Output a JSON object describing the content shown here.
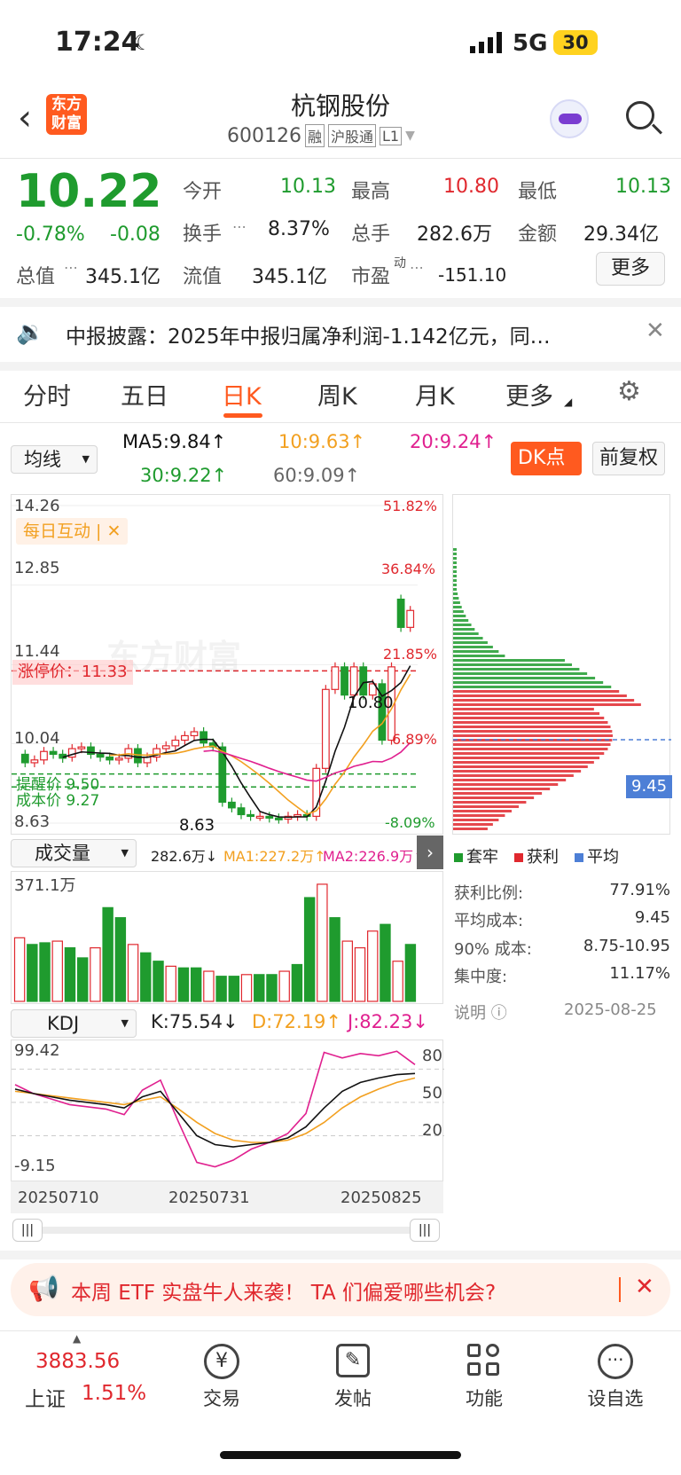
{
  "status_bar": {
    "time": "17:24",
    "network": "5G",
    "battery": "30"
  },
  "header": {
    "title": "杭钢股份",
    "logo": "东方财富",
    "code": "600126",
    "tags": [
      "融",
      "沪股通",
      "L1"
    ]
  },
  "quote": {
    "price": "10.22",
    "change_pct": "-0.78%",
    "change": "-0.08",
    "open_label": "今开",
    "open": "10.13",
    "high_label": "最高",
    "high": "10.80",
    "low_label": "最低",
    "low": "10.13",
    "turnover_label": "换手",
    "turnover": "8.37%",
    "volume_label": "总手",
    "volume": "282.6万",
    "amount_label": "金额",
    "amount": "29.34亿",
    "mktcap_label": "总值",
    "mktcap": "345.1亿",
    "float_label": "流值",
    "float": "345.1亿",
    "pe_label": "市盈",
    "pe_sup": "动",
    "pe": "-151.10",
    "more": "更多"
  },
  "notice": {
    "text": "中报披露：2025年中报归属净利润-1.142亿元，同…"
  },
  "tabs": [
    "分时",
    "五日",
    "日K",
    "周K",
    "月K",
    "更多"
  ],
  "active_tab": 2,
  "ma_bar": {
    "selector": "均线",
    "ma5": "MA5:9.84↑",
    "ma10": "10:9.63↑",
    "ma20": "20:9.24↑",
    "ma30": "30:9.22↑",
    "ma60": "60:9.09↑",
    "dk": "DK点",
    "fq": "前复权"
  },
  "colors": {
    "ma5": "#111111",
    "ma10": "#f2a020",
    "ma20": "#e0208f",
    "ma30": "#1f9b2e",
    "ma60": "#888888",
    "up": "#e0282e",
    "down": "#1f9b2e",
    "brand": "#ff5a1f"
  },
  "kchart": {
    "ymax": "14.26",
    "y2": "12.85",
    "y3": "11.44",
    "y4": "10.04",
    "ymin": "8.63",
    "pct_1": "51.82%",
    "pct_2": "36.84%",
    "pct_3": "21.85%",
    "pct_4": "6.89%",
    "pct_5": "-8.09%",
    "limit_up": "涨停价：11.33",
    "alert": "提醒价 9.50",
    "cost": "成本价 9.27",
    "high_mark": "10.80",
    "low_mark": "8.63",
    "interact": "每日互动 | ✕",
    "watermark": "东方财富",
    "chip_avg": "9.45"
  },
  "chart_data": {
    "type": "candlestick",
    "ylim": [
      8.63,
      14.26
    ],
    "candles": [
      {
        "o": 9.85,
        "c": 9.7
      },
      {
        "o": 9.7,
        "c": 9.75
      },
      {
        "o": 9.75,
        "c": 9.9
      },
      {
        "o": 9.9,
        "c": 9.85
      },
      {
        "o": 9.85,
        "c": 9.78
      },
      {
        "o": 9.8,
        "c": 9.95
      },
      {
        "o": 9.95,
        "c": 9.98
      },
      {
        "o": 9.98,
        "c": 9.85
      },
      {
        "o": 9.85,
        "c": 9.8
      },
      {
        "o": 9.8,
        "c": 9.75
      },
      {
        "o": 9.75,
        "c": 9.78
      },
      {
        "o": 9.78,
        "c": 9.95
      },
      {
        "o": 9.95,
        "c": 9.7
      },
      {
        "o": 9.7,
        "c": 9.8
      },
      {
        "o": 9.8,
        "c": 9.95
      },
      {
        "o": 9.95,
        "c": 10.0
      },
      {
        "o": 10.0,
        "c": 10.1
      },
      {
        "o": 10.1,
        "c": 10.18
      },
      {
        "o": 10.18,
        "c": 10.25
      },
      {
        "o": 10.25,
        "c": 10.05
      },
      {
        "o": 10.05,
        "c": 9.98
      },
      {
        "o": 9.98,
        "c": 9.0
      },
      {
        "o": 9.0,
        "c": 8.9
      },
      {
        "o": 8.9,
        "c": 8.78
      },
      {
        "o": 8.78,
        "c": 8.75
      },
      {
        "o": 8.75,
        "c": 8.75
      },
      {
        "o": 8.75,
        "c": 8.72
      },
      {
        "o": 8.72,
        "c": 8.7
      },
      {
        "o": 8.7,
        "c": 8.75
      },
      {
        "o": 8.75,
        "c": 8.78
      },
      {
        "o": 8.78,
        "c": 8.75
      },
      {
        "o": 8.75,
        "c": 9.6
      },
      {
        "o": 9.6,
        "c": 11.0
      },
      {
        "o": 11.0,
        "c": 11.4
      },
      {
        "o": 11.4,
        "c": 10.9
      },
      {
        "o": 10.9,
        "c": 11.4
      },
      {
        "o": 11.4,
        "c": 10.9
      },
      {
        "o": 10.9,
        "c": 11.1
      },
      {
        "o": 11.1,
        "c": 10.1
      },
      {
        "o": 10.1,
        "c": 11.4
      },
      {
        "o": 12.6,
        "c": 12.1
      },
      {
        "o": 12.1,
        "c": 12.4
      }
    ],
    "volume": {
      "ymax": "371.1万",
      "now": "282.6万↓",
      "ma1": "MA1:227.2万↑",
      "ma2": "MA2:226.9万↑",
      "values": [
        190,
        170,
        175,
        180,
        160,
        130,
        160,
        280,
        250,
        170,
        145,
        120,
        105,
        100,
        100,
        90,
        75,
        75,
        80,
        80,
        80,
        90,
        110,
        310,
        350,
        250,
        180,
        160,
        210,
        230,
        120,
        170
      ]
    },
    "kdj": {
      "title": "KDJ",
      "k": "K:75.54↓",
      "d": "D:72.19↑",
      "j": "J:82.23↓",
      "ymax": "99.42",
      "ymin": "-9.15",
      "levels": [
        "80",
        "50",
        "20"
      ]
    },
    "dates": [
      "20250710",
      "20250731",
      "20250825"
    ]
  },
  "chip_panel": {
    "legend": [
      "套牢",
      "获利",
      "平均"
    ],
    "rows": [
      {
        "label": "获利比例:",
        "value": "77.91%"
      },
      {
        "label": "平均成本:",
        "value": "9.45"
      },
      {
        "label": "90% 成本:",
        "value": "8.75-10.95"
      },
      {
        "label": "集中度:",
        "value": "11.17%"
      }
    ],
    "note": "说明",
    "date": "2025-08-25"
  },
  "banner": {
    "text": "本周 ETF 实盘牛人来袭！ TA 们偏爱哪些机会?"
  },
  "bottom_nav": {
    "index_value": "3883.56",
    "index_name": "上证",
    "index_pct": "1.51%",
    "items": [
      "交易",
      "发帖",
      "功能",
      "设自选"
    ]
  }
}
